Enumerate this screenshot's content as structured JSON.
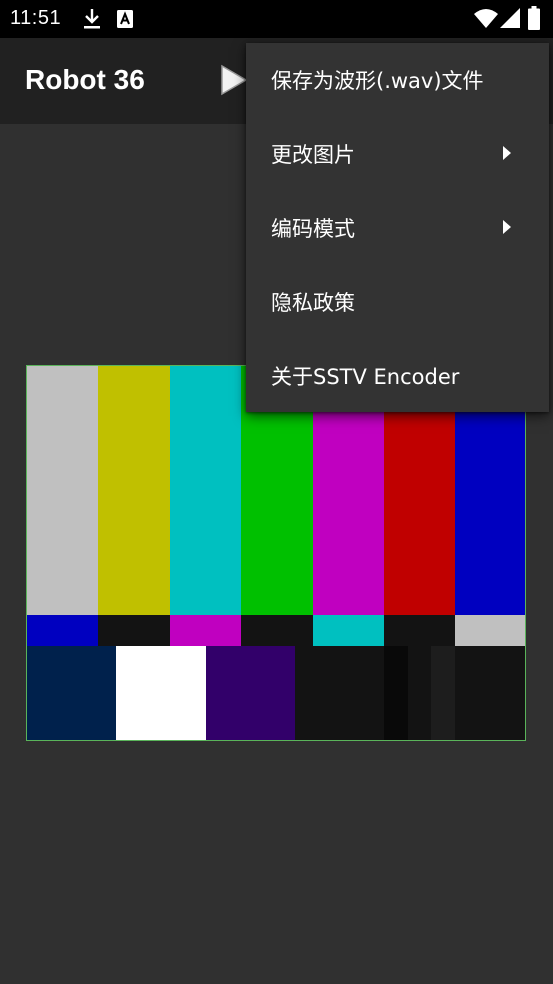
{
  "status_bar": {
    "time": "11:51",
    "icons": [
      "download-icon",
      "text-a-icon",
      "wifi-icon",
      "signal-icon",
      "battery-icon"
    ]
  },
  "app_bar": {
    "title": "Robot 36",
    "play_icon": "play-icon"
  },
  "menu": {
    "items": [
      {
        "label": "保存为波形(.wav)文件",
        "has_submenu": false
      },
      {
        "label": "更改图片",
        "has_submenu": true
      },
      {
        "label": "编码模式",
        "has_submenu": true
      },
      {
        "label": "隐私政策",
        "has_submenu": false
      },
      {
        "label": "关于SSTV Encoder",
        "has_submenu": false
      }
    ]
  },
  "colors": {
    "status_bar": "#000000",
    "app_bar": "#212121",
    "background": "#303030",
    "menu_background": "#333333",
    "test_pattern_top": [
      "#c0c0c0",
      "#c0c000",
      "#00c0c0",
      "#00c000",
      "#c000c0",
      "#c00000",
      "#0000c0"
    ],
    "test_pattern_middle": [
      "#0000c0",
      "#131313",
      "#c000c0",
      "#131313",
      "#00c0c0",
      "#131313",
      "#c0c0c0"
    ],
    "test_pattern_bottom": [
      "#00214c",
      "#ffffff",
      "#32006a",
      "#131313",
      "#090909",
      "#131313",
      "#1d1d1d",
      "#131313"
    ]
  }
}
